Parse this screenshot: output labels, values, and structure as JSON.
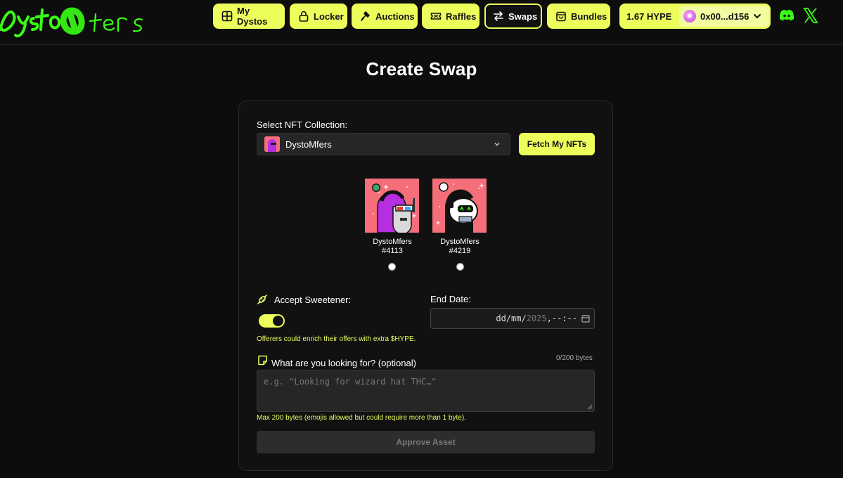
{
  "header": {
    "logo_text": "Dystomfers",
    "nav": [
      {
        "label": "My Dystos",
        "icon": "grid-icon"
      },
      {
        "label": "Locker",
        "icon": "lock-icon"
      },
      {
        "label": "Auctions",
        "icon": "gavel-icon"
      },
      {
        "label": "Raffles",
        "icon": "ticket-icon"
      },
      {
        "label": "Swaps",
        "icon": "swap-arrows-icon",
        "active": true
      },
      {
        "label": "Bundles",
        "icon": "bag-icon"
      }
    ],
    "wallet": {
      "balance": "1.67 HYPE",
      "address": "0x00...d156"
    },
    "social": [
      "discord-icon",
      "x-icon"
    ]
  },
  "page": {
    "title": "Create Swap",
    "collection_label": "Select NFT Collection:",
    "collection_selected": "DystoMfers",
    "fetch_button": "Fetch My NFTs",
    "nfts": [
      {
        "collection": "DystoMfers",
        "id": "#4113"
      },
      {
        "collection": "DystoMfers",
        "id": "#4219"
      }
    ],
    "sweetener_label": "Accept Sweetener:",
    "sweetener_enabled": true,
    "sweetener_hint": "Offerers could enrich their offers with extra $HYPE.",
    "end_date_label": "End Date:",
    "end_date": {
      "dd": "dd",
      "mm": "mm",
      "year": "2025",
      "time": "--:--"
    },
    "looking_label": "What are you looking for? (optional)",
    "byte_count": "0/200 bytes",
    "looking_placeholder": "e.g. \"Looking for wizard hat THC…\"",
    "max_hint": "Max 200 bytes (emojis allowed but could require more than 1 byte).",
    "approve_button": "Approve Asset"
  },
  "colors": {
    "accent": "#ecfd5c",
    "background": "#0d0d0d",
    "card": "#111111",
    "logo_green": "#39ff14",
    "nft_bg": "#f46f79"
  }
}
